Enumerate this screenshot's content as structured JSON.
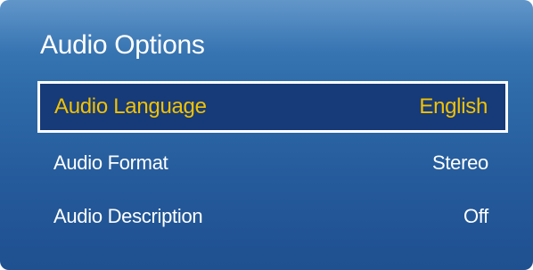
{
  "menu": {
    "title": "Audio Options",
    "items": [
      {
        "label": "Audio Language",
        "value": "English",
        "selected": true
      },
      {
        "label": "Audio Format",
        "value": "Stereo",
        "selected": false
      },
      {
        "label": "Audio Description",
        "value": "Off",
        "selected": false
      }
    ]
  },
  "colors": {
    "panel_background": "#2e6aa8",
    "selected_background": "#173a78",
    "selected_text": "#f2c200",
    "text": "#ffffff"
  }
}
